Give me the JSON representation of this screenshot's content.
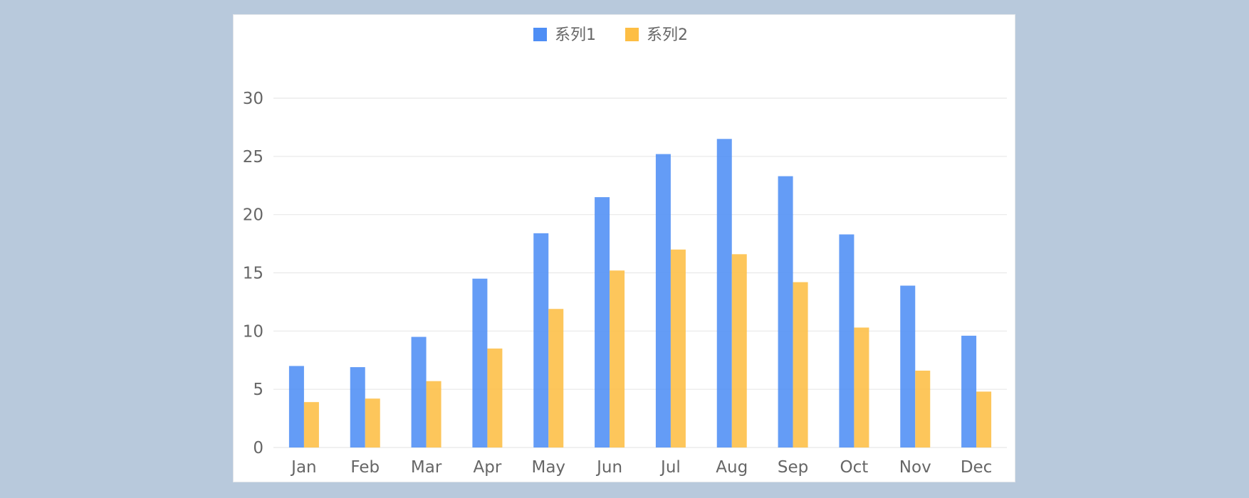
{
  "chart_data": {
    "type": "bar",
    "categories": [
      "Jan",
      "Feb",
      "Mar",
      "Apr",
      "May",
      "Jun",
      "Jul",
      "Aug",
      "Sep",
      "Oct",
      "Nov",
      "Dec"
    ],
    "series": [
      {
        "name": "系列1",
        "color": "#4e8ef5",
        "values": [
          7.0,
          6.9,
          9.5,
          14.5,
          18.4,
          21.5,
          25.2,
          26.5,
          23.3,
          18.3,
          13.9,
          9.6
        ]
      },
      {
        "name": "系列2",
        "color": "#fdbe44",
        "values": [
          3.9,
          4.2,
          5.7,
          8.5,
          11.9,
          15.2,
          17.0,
          16.6,
          14.2,
          10.3,
          6.6,
          4.8
        ]
      }
    ],
    "yticks": [
      "0",
      "5",
      "10",
      "15",
      "20",
      "25",
      "30"
    ],
    "ylim": [
      0,
      30
    ],
    "grid": true,
    "legend_position": "top-center",
    "title": "",
    "xlabel": "",
    "ylabel": ""
  }
}
